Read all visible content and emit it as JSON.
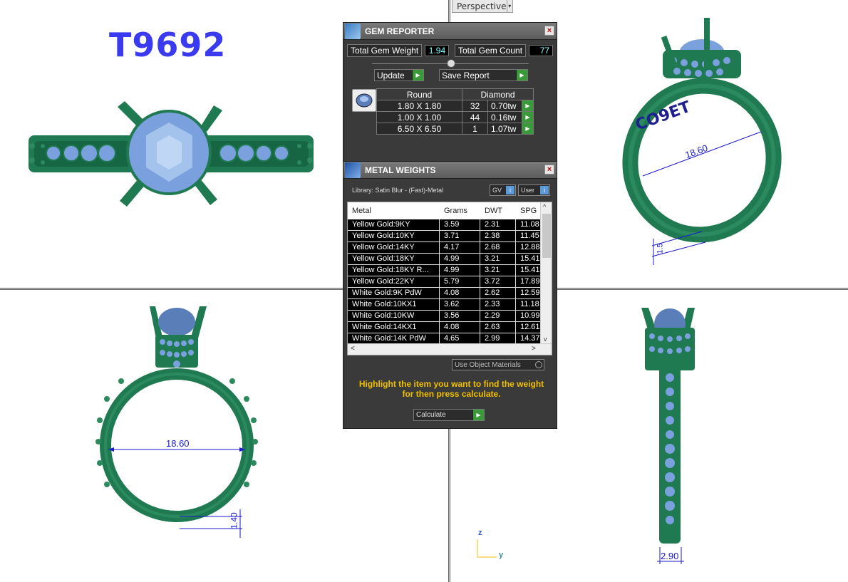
{
  "viewport": {
    "perspective_label": "Perspective",
    "dropdown_arrow": "▾"
  },
  "design_id": "T9692",
  "dimensions": {
    "top_right_diameter": "18.60",
    "bottom_left_diameter": "18.60",
    "bottom_left_thickness": "1.40",
    "bottom_right_width": "2.90",
    "top_right_small": "1.5"
  },
  "axis": {
    "z": "z",
    "y": "y"
  },
  "colors": {
    "metal": "#1f7a52",
    "gem": "#7aa0dd",
    "dim": "#1a1ad0",
    "title": "#3a3af0",
    "panel_bg": "#3a3a3a",
    "hint": "#f0c000"
  },
  "gem_reporter": {
    "title": "GEM REPORTER",
    "close": "×",
    "total_weight_label": "Total Gem Weight",
    "total_weight_value": "1.94",
    "total_count_label": "Total Gem Count",
    "total_count_value": "77",
    "update_label": "Update",
    "save_report_label": "Save Report",
    "table_header": {
      "shape": "Round",
      "type": "Diamond"
    },
    "rows": [
      {
        "size": "1.80 X 1.80",
        "count": "32",
        "weight": "0.70tw"
      },
      {
        "size": "1.00 X 1.00",
        "count": "44",
        "weight": "0.16tw"
      },
      {
        "size": "6.50 X 6.50",
        "count": "1",
        "weight": "1.07tw"
      }
    ]
  },
  "metal_weights": {
    "title": "METAL WEIGHTS",
    "close": "×",
    "library": "Library: Satin Blur - (Fast)-Metal",
    "gv_label": "GV",
    "user_label": "User",
    "info": "i",
    "columns": [
      "Metal",
      "Grams",
      "DWT",
      "SPG"
    ],
    "rows": [
      [
        "Yellow Gold:9KY",
        "3.59",
        "2.31",
        "11.08"
      ],
      [
        "Yellow Gold:10KY",
        "3.71",
        "2.38",
        "11.45"
      ],
      [
        "Yellow Gold:14KY",
        "4.17",
        "2.68",
        "12.88"
      ],
      [
        "Yellow Gold:18KY",
        "4.99",
        "3.21",
        "15.41"
      ],
      [
        "Yellow Gold:18KY R...",
        "4.99",
        "3.21",
        "15.41"
      ],
      [
        "Yellow Gold:22KY",
        "5.79",
        "3.72",
        "17.89"
      ],
      [
        "White Gold:9K PdW",
        "4.08",
        "2.62",
        "12.59"
      ],
      [
        "White Gold:10KX1",
        "3.62",
        "2.33",
        "11.18"
      ],
      [
        "White Gold:10KW",
        "3.56",
        "2.29",
        "10.99"
      ],
      [
        "White Gold:14KX1",
        "4.08",
        "2.63",
        "12.61"
      ],
      [
        "White Gold:14K PdW",
        "4.65",
        "2.99",
        "14.37"
      ]
    ],
    "use_object_materials": "Use Object Materials",
    "hint": "Highlight the item you want to find the weight for then press calculate.",
    "calculate_label": "Calculate",
    "scroll_left": "<",
    "scroll_right": ">",
    "scroll_up": "^",
    "scroll_down": "v"
  }
}
